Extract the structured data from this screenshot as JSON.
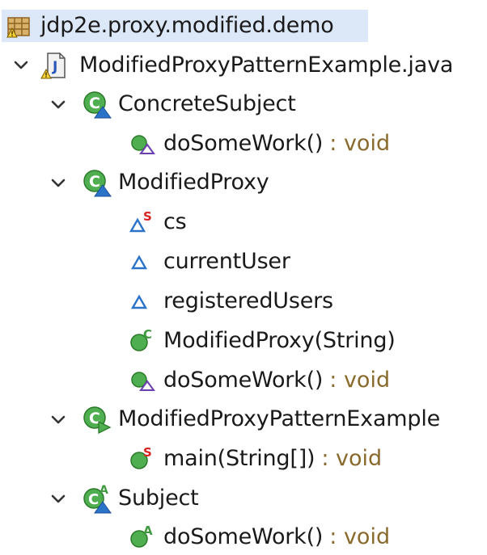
{
  "tree": {
    "project": {
      "label": "jdp2e.proxy.modified.demo",
      "icon": "package-icon"
    },
    "file": {
      "label": "ModifiedProxyPatternExample.java",
      "icon": "java-file-icon",
      "expanded": true
    },
    "nodes": [
      {
        "kind": "class",
        "label": "ConcreteSubject",
        "icon": "class-default-icon",
        "expanded": true
      },
      {
        "kind": "method",
        "label": "doSomeWork()",
        "type": ": void",
        "icon": "method-default-icon"
      },
      {
        "kind": "class",
        "label": "ModifiedProxy",
        "icon": "class-default-icon",
        "expanded": true
      },
      {
        "kind": "field",
        "label": "cs",
        "icon": "field-static-icon",
        "badge": "S"
      },
      {
        "kind": "field",
        "label": "currentUser",
        "icon": "field-default-icon"
      },
      {
        "kind": "field",
        "label": "registeredUsers",
        "icon": "field-default-icon"
      },
      {
        "kind": "constructor",
        "label": "ModifiedProxy(String)",
        "icon": "constructor-icon",
        "badge": "C"
      },
      {
        "kind": "method",
        "label": "doSomeWork()",
        "type": ": void",
        "icon": "method-default-icon"
      },
      {
        "kind": "class",
        "label": "ModifiedProxyPatternExample",
        "icon": "class-public-icon",
        "expanded": true
      },
      {
        "kind": "method",
        "label": "main(String[])",
        "type": ": void",
        "icon": "method-static-icon",
        "badge": "S"
      },
      {
        "kind": "class",
        "label": "Subject",
        "icon": "abstract-class-icon",
        "badge": "A",
        "expanded": true
      },
      {
        "kind": "method",
        "label": "doSomeWork()",
        "type": ": void",
        "icon": "method-abstract-icon",
        "badge": "A"
      }
    ]
  },
  "colors": {
    "selection": "#dce8f7",
    "type_text": "#8a6a2c",
    "class_green": "#3f9a3f",
    "default_blue": "#2b73c9",
    "static_red": "#d8231f"
  }
}
